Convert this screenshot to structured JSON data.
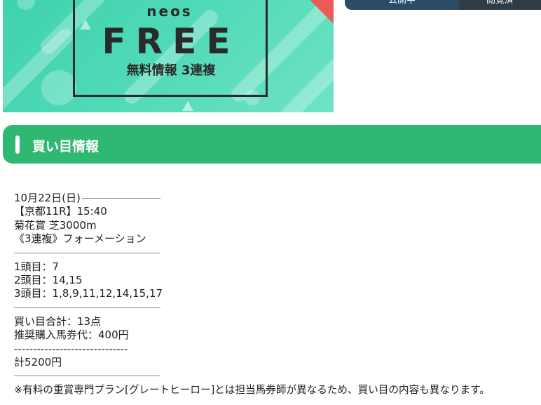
{
  "banner": {
    "brand": "neos",
    "headline": "FREE",
    "subtitle": "無料情報 3連複"
  },
  "tabs": [
    {
      "label": "公開中"
    },
    {
      "label": "閲覧済"
    }
  ],
  "section": {
    "title": "買い目情報"
  },
  "race": {
    "date": "10月22日(日)",
    "venue_time": "【京都11R】15:40",
    "race_name": "菊花賞 芝3000m",
    "bet_type": "《3連複》フォーメーション"
  },
  "picks": {
    "first": "1頭目：7",
    "second": "2頭目：14,15",
    "third": "3頭目：1,8,9,11,12,14,15,17"
  },
  "summary": {
    "total_points": "買い目合計：13点",
    "recommended": "推奨購入馬券代：400円",
    "separator": "------------------------------",
    "total": "計5200円"
  },
  "note": "※有料の重賞専門プラン[グレートヒーロー]とは担当馬券師が異なるため、買い目の内容も異なります。",
  "colors": {
    "accent_green": "#2fb872",
    "banner_teal": "#4fd9b6",
    "tab_dark": "#2b4c66"
  }
}
